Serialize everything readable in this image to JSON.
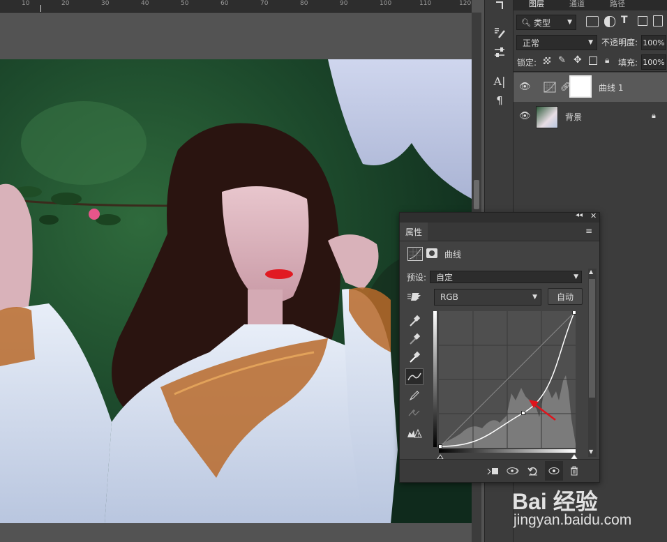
{
  "ruler": {
    "ticks": [
      "10",
      "20",
      "30",
      "40",
      "50",
      "60",
      "70",
      "80",
      "90",
      "100",
      "110",
      "120"
    ]
  },
  "toolstrip": {
    "items": [
      "move-tool",
      "brush-settings",
      "adjust-sliders",
      "character-panel",
      "paragraph-panel"
    ]
  },
  "layers_panel": {
    "tabs": [
      "图层",
      "通道",
      "路径"
    ],
    "filter_label": "类型",
    "blend_mode": "正常",
    "opacity_label": "不透明度:",
    "opacity_value": "100%",
    "lock_label": "锁定:",
    "fill_label": "填充:",
    "fill_value": "100%",
    "layers": [
      {
        "name": "曲线 1",
        "type": "adjustment",
        "selected": true
      },
      {
        "name": "背景",
        "type": "image",
        "locked": true
      }
    ]
  },
  "properties_panel": {
    "tab": "属性",
    "title": "曲线",
    "preset_label": "预设:",
    "preset_value": "自定",
    "channel": "RGB",
    "auto_label": "自动",
    "curve_points": [
      [
        0,
        0
      ],
      [
        0.62,
        0.25
      ],
      [
        1,
        1
      ]
    ]
  },
  "watermark": {
    "brand": "Bai 经验",
    "url": "jingyan.baidu.com"
  },
  "colors": {
    "panel": "#3c3c3c",
    "panel_dark": "#2d2d2d",
    "accent_red": "#e0141c"
  }
}
